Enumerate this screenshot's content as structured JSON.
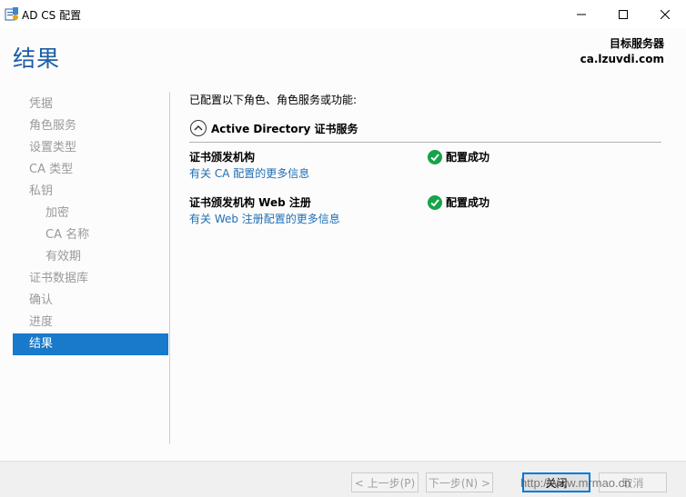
{
  "window": {
    "title": "AD CS 配置",
    "minimize_glyph": "—",
    "maximize_glyph": "☐",
    "close_glyph": "✕"
  },
  "header": {
    "page_title": "结果",
    "target_label": "目标服务器",
    "target_value": "ca.lzuvdi.com"
  },
  "nav": {
    "items": [
      {
        "label": "凭据"
      },
      {
        "label": "角色服务"
      },
      {
        "label": "设置类型"
      },
      {
        "label": "CA 类型"
      },
      {
        "label": "私钥"
      },
      {
        "label": "加密"
      },
      {
        "label": "CA 名称"
      },
      {
        "label": "有效期"
      },
      {
        "label": "证书数据库"
      },
      {
        "label": "确认"
      },
      {
        "label": "进度"
      },
      {
        "label": "结果"
      }
    ]
  },
  "content": {
    "intro": "已配置以下角色、角色服务或功能:",
    "section_title": "Active Directory 证书服务",
    "rows": [
      {
        "name": "证书颁发机构",
        "link": "有关 CA 配置的更多信息",
        "status": "配置成功"
      },
      {
        "name": "证书颁发机构 Web 注册",
        "link": "有关 Web 注册配置的更多信息",
        "status": "配置成功"
      }
    ]
  },
  "footer": {
    "prev_label": "< 上一步(P)",
    "next_label": "下一步(N) >",
    "close_label": "关闭",
    "cancel_label": "取消"
  },
  "watermark": "http://www.mrmao.cn",
  "colors": {
    "accent": "#1979ca",
    "link": "#1e6fb5",
    "success": "#16a34a"
  }
}
